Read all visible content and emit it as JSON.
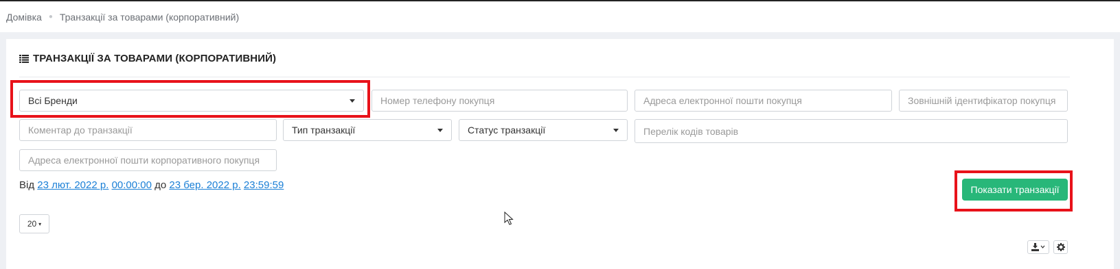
{
  "breadcrumb": {
    "home": "Домівка",
    "current": "Транзакції за товарами (корпоративний)"
  },
  "card": {
    "title": "ТРАНЗАКЦІЇ ЗА ТОВАРАМИ (КОРПОРАТИВНИЙ)",
    "title_icon": "list-icon"
  },
  "filters": {
    "brand_select": "Всі Бренди",
    "buyer_phone_placeholder": "Номер телефону покупця",
    "buyer_email_placeholder": "Адреса електронної пошти покупця",
    "external_id_placeholder": "Зовнішній ідентифікатор покупця",
    "comment_placeholder": "Коментар до транзакції",
    "type_select": "Тип транзакції",
    "status_select": "Статус транзакції",
    "product_codes_placeholder": "Перелік кодів товарів",
    "corporate_email_placeholder": "Адреса електронної пошти корпоративного покупця"
  },
  "date_range": {
    "from_label": "Від",
    "from_date": "23 лют. 2022 р.",
    "from_time": "00:00:00",
    "to_label": "до",
    "to_date": "23 бер. 2022 р.",
    "to_time": "23:59:59"
  },
  "actions": {
    "show_button": "Показати транзакції"
  },
  "pagination": {
    "page_size": "20"
  },
  "toolbar": {
    "export_icon": "download-icon",
    "settings_icon": "gear-icon"
  },
  "colors": {
    "accent_green": "#28b779",
    "link_blue": "#1a7fd6",
    "highlight_red": "#e8121a"
  }
}
